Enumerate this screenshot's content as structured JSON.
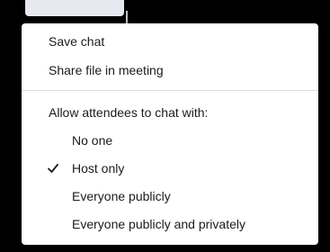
{
  "menu": {
    "items": [
      {
        "label": "Save chat"
      },
      {
        "label": "Share file in meeting"
      }
    ],
    "section_heading": "Allow attendees to chat with:",
    "options": [
      {
        "label": "No one",
        "checked": false
      },
      {
        "label": "Host only",
        "checked": true
      },
      {
        "label": "Everyone publicly",
        "checked": false
      },
      {
        "label": "Everyone publicly and privately",
        "checked": false
      }
    ],
    "check_icon": "checkmark-icon"
  },
  "colors": {
    "background": "#000000",
    "menu": "#ffffff",
    "text": "#1b1b1b",
    "separator": "#dcdcdc"
  }
}
